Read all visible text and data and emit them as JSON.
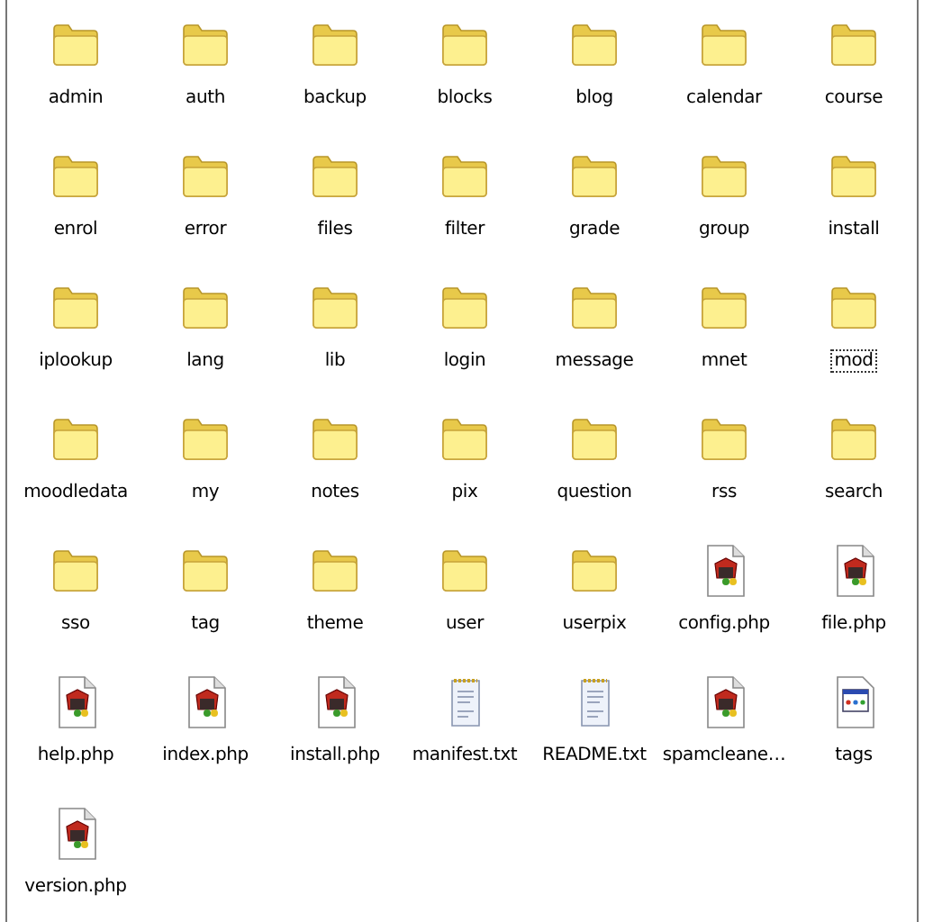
{
  "items": [
    {
      "name": "admin",
      "kind": "folder",
      "focused": false
    },
    {
      "name": "auth",
      "kind": "folder",
      "focused": false
    },
    {
      "name": "backup",
      "kind": "folder",
      "focused": false
    },
    {
      "name": "blocks",
      "kind": "folder",
      "focused": false
    },
    {
      "name": "blog",
      "kind": "folder",
      "focused": false
    },
    {
      "name": "calendar",
      "kind": "folder",
      "focused": false
    },
    {
      "name": "course",
      "kind": "folder",
      "focused": false
    },
    {
      "name": "enrol",
      "kind": "folder",
      "focused": false
    },
    {
      "name": "error",
      "kind": "folder",
      "focused": false
    },
    {
      "name": "files",
      "kind": "folder",
      "focused": false
    },
    {
      "name": "filter",
      "kind": "folder",
      "focused": false
    },
    {
      "name": "grade",
      "kind": "folder",
      "focused": false
    },
    {
      "name": "group",
      "kind": "folder",
      "focused": false
    },
    {
      "name": "install",
      "kind": "folder",
      "focused": false
    },
    {
      "name": "iplookup",
      "kind": "folder",
      "focused": false
    },
    {
      "name": "lang",
      "kind": "folder",
      "focused": false
    },
    {
      "name": "lib",
      "kind": "folder",
      "focused": false
    },
    {
      "name": "login",
      "kind": "folder",
      "focused": false
    },
    {
      "name": "message",
      "kind": "folder",
      "focused": false
    },
    {
      "name": "mnet",
      "kind": "folder",
      "focused": false
    },
    {
      "name": "mod",
      "kind": "folder",
      "focused": true
    },
    {
      "name": "moodledata",
      "kind": "folder",
      "focused": false
    },
    {
      "name": "my",
      "kind": "folder",
      "focused": false
    },
    {
      "name": "notes",
      "kind": "folder",
      "focused": false
    },
    {
      "name": "pix",
      "kind": "folder",
      "focused": false
    },
    {
      "name": "question",
      "kind": "folder",
      "focused": false
    },
    {
      "name": "rss",
      "kind": "folder",
      "focused": false
    },
    {
      "name": "search",
      "kind": "folder",
      "focused": false
    },
    {
      "name": "sso",
      "kind": "folder",
      "focused": false
    },
    {
      "name": "tag",
      "kind": "folder",
      "focused": false
    },
    {
      "name": "theme",
      "kind": "folder",
      "focused": false
    },
    {
      "name": "user",
      "kind": "folder",
      "focused": false
    },
    {
      "name": "userpix",
      "kind": "folder",
      "focused": false
    },
    {
      "name": "config.php",
      "kind": "php",
      "focused": false
    },
    {
      "name": "file.php",
      "kind": "php",
      "focused": false
    },
    {
      "name": "help.php",
      "kind": "php",
      "focused": false
    },
    {
      "name": "index.php",
      "kind": "php",
      "focused": false
    },
    {
      "name": "install.php",
      "kind": "php",
      "focused": false
    },
    {
      "name": "manifest.txt",
      "kind": "txt",
      "focused": false
    },
    {
      "name": "README.txt",
      "kind": "txt",
      "focused": false
    },
    {
      "name": "spamcleane…",
      "kind": "php",
      "focused": false
    },
    {
      "name": "tags",
      "kind": "window",
      "focused": false
    },
    {
      "name": "version.php",
      "kind": "php",
      "focused": false
    }
  ]
}
